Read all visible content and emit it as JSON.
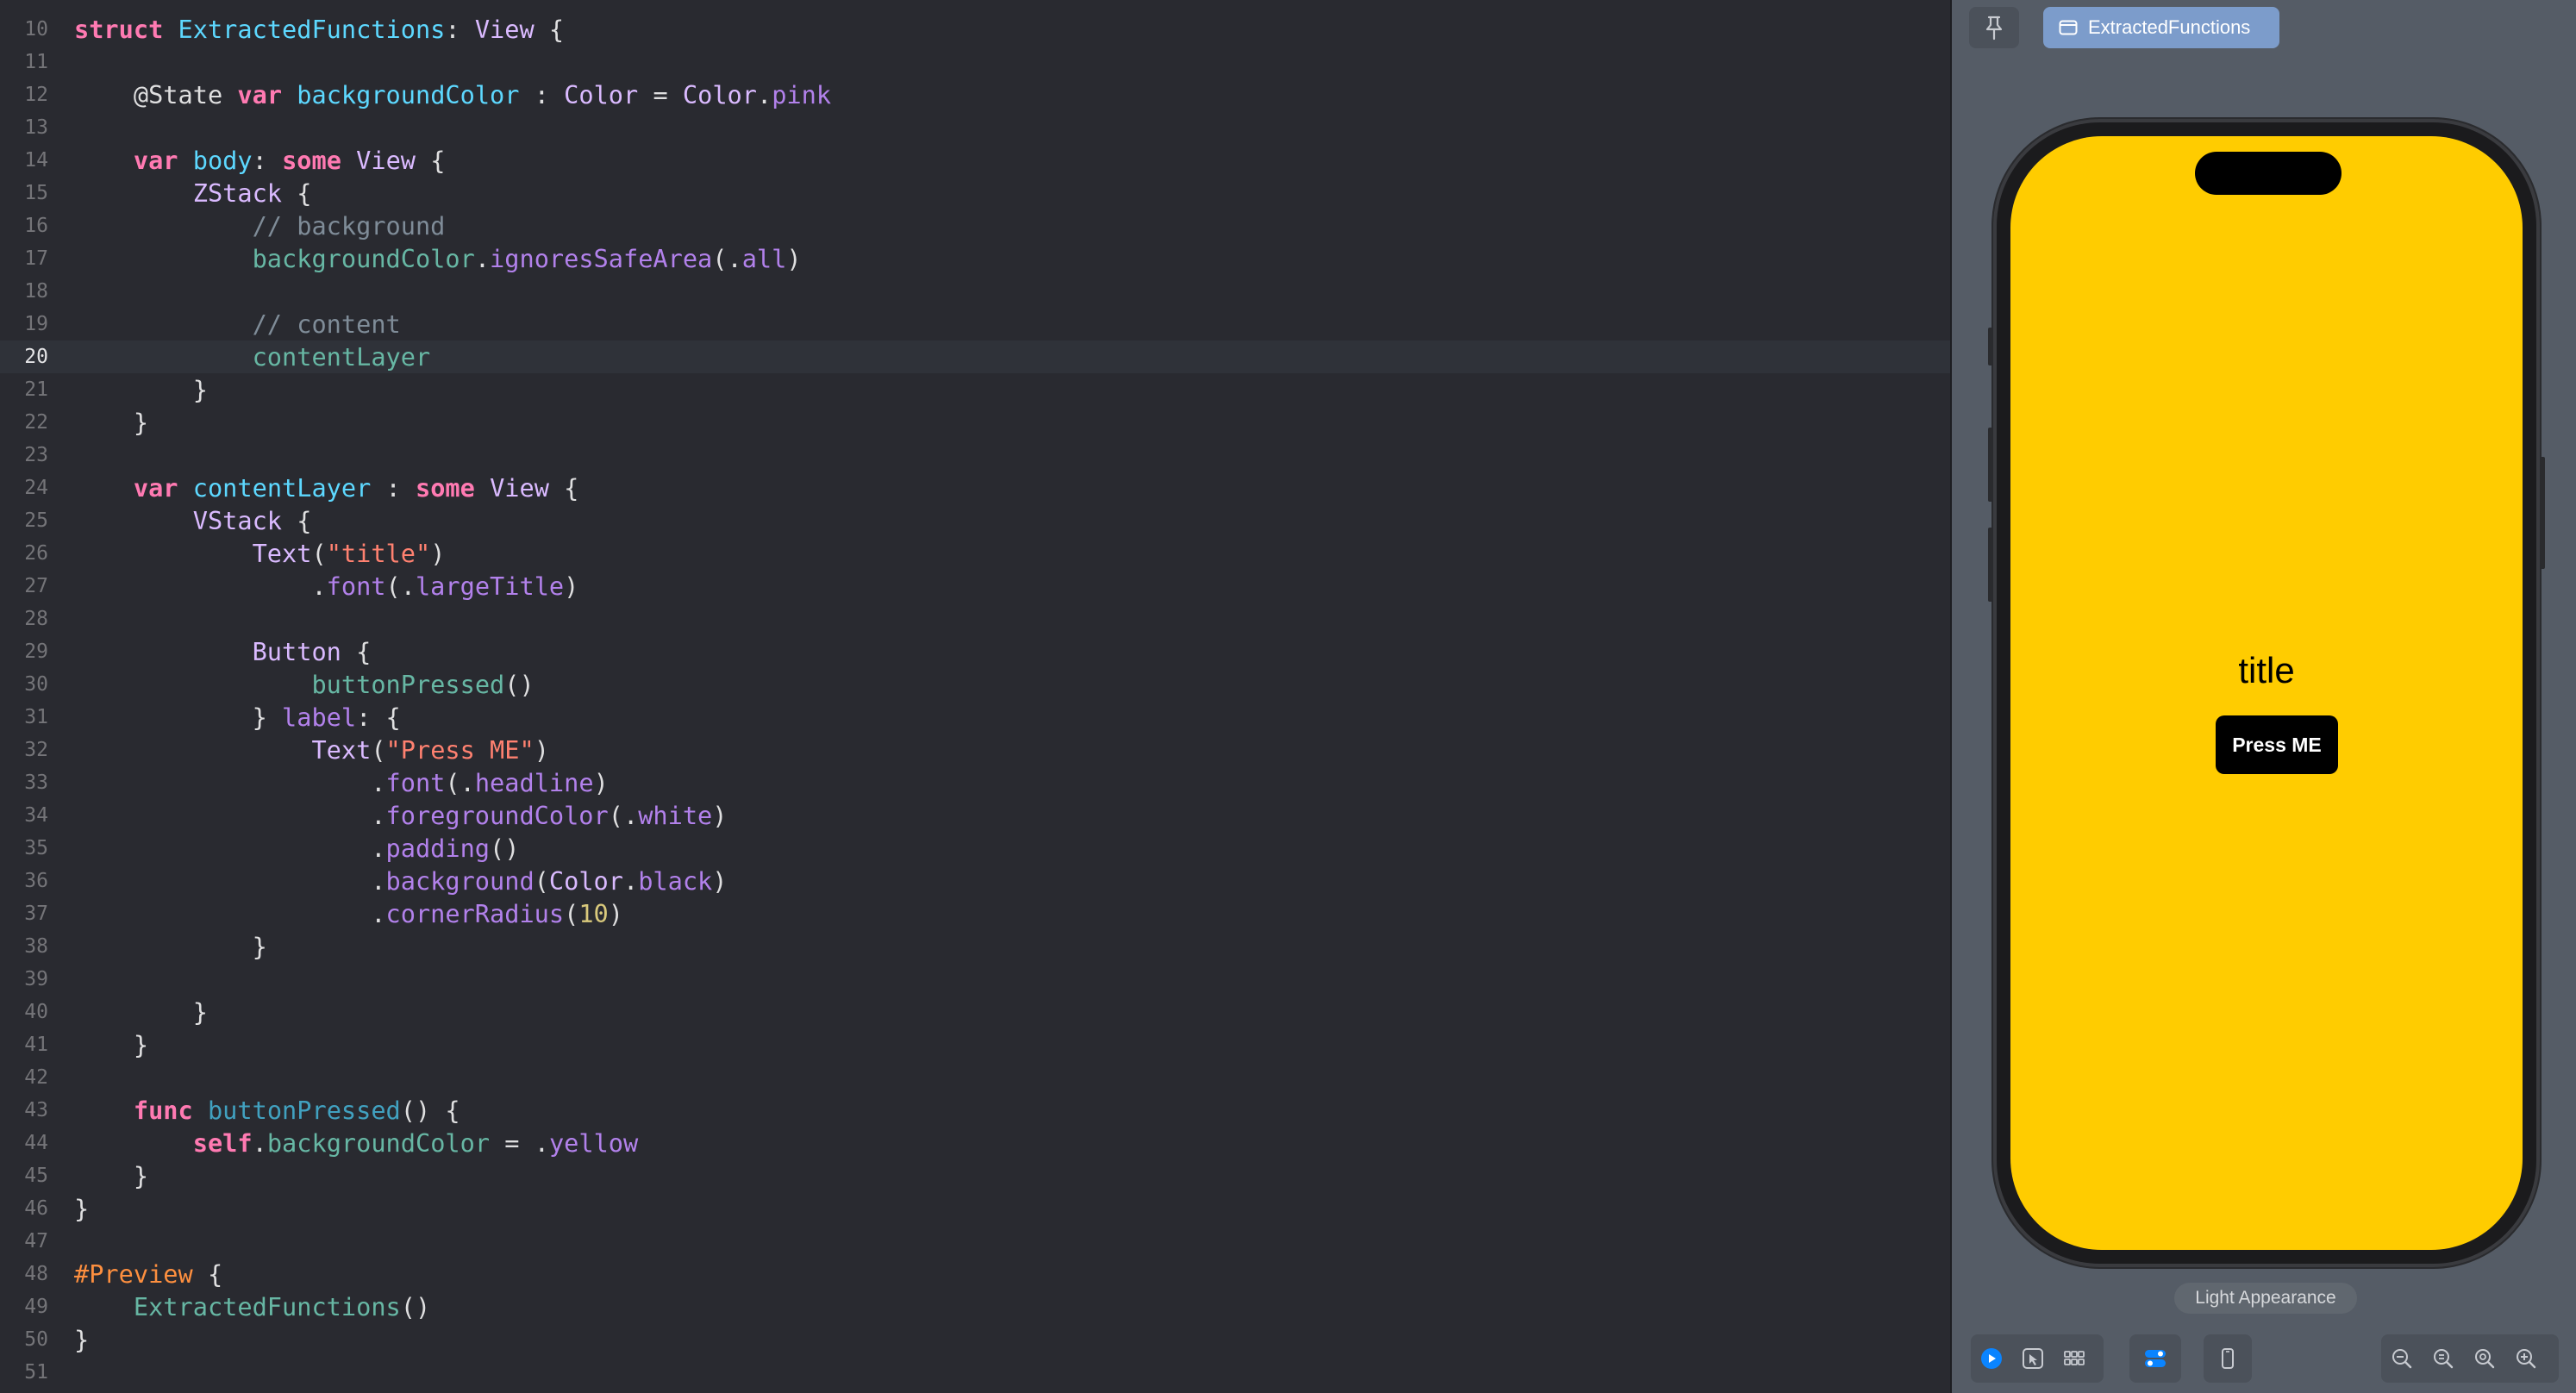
{
  "editor": {
    "current_line": 20,
    "lines": [
      {
        "n": 10,
        "tokens": [
          {
            "t": "struct",
            "c": "kw"
          },
          {
            "t": " ",
            "c": "plain"
          },
          {
            "t": "ExtractedFunctions",
            "c": "decl"
          },
          {
            "t": ": ",
            "c": "plain"
          },
          {
            "t": "View",
            "c": "type"
          },
          {
            "t": " {",
            "c": "plain"
          }
        ]
      },
      {
        "n": 11,
        "tokens": []
      },
      {
        "n": 12,
        "tokens": [
          {
            "t": "    ",
            "c": "plain"
          },
          {
            "t": "@State",
            "c": "attr"
          },
          {
            "t": " ",
            "c": "plain"
          },
          {
            "t": "var",
            "c": "kw"
          },
          {
            "t": " ",
            "c": "plain"
          },
          {
            "t": "backgroundColor",
            "c": "decl"
          },
          {
            "t": " : ",
            "c": "plain"
          },
          {
            "t": "Color",
            "c": "type"
          },
          {
            "t": " = ",
            "c": "plain"
          },
          {
            "t": "Color",
            "c": "type"
          },
          {
            "t": ".",
            "c": "plain"
          },
          {
            "t": "pink",
            "c": "mem"
          }
        ]
      },
      {
        "n": 13,
        "tokens": []
      },
      {
        "n": 14,
        "tokens": [
          {
            "t": "    ",
            "c": "plain"
          },
          {
            "t": "var",
            "c": "kw"
          },
          {
            "t": " ",
            "c": "plain"
          },
          {
            "t": "body",
            "c": "decl"
          },
          {
            "t": ": ",
            "c": "plain"
          },
          {
            "t": "some",
            "c": "kw"
          },
          {
            "t": " ",
            "c": "plain"
          },
          {
            "t": "View",
            "c": "type"
          },
          {
            "t": " {",
            "c": "plain"
          }
        ]
      },
      {
        "n": 15,
        "tokens": [
          {
            "t": "        ",
            "c": "plain"
          },
          {
            "t": "ZStack",
            "c": "type"
          },
          {
            "t": " {",
            "c": "plain"
          }
        ]
      },
      {
        "n": 16,
        "tokens": [
          {
            "t": "            ",
            "c": "plain"
          },
          {
            "t": "// background",
            "c": "cmt"
          }
        ]
      },
      {
        "n": 17,
        "tokens": [
          {
            "t": "            ",
            "c": "plain"
          },
          {
            "t": "backgroundColor",
            "c": "prop"
          },
          {
            "t": ".",
            "c": "plain"
          },
          {
            "t": "ignoresSafeArea",
            "c": "mem"
          },
          {
            "t": "(.",
            "c": "plain"
          },
          {
            "t": "all",
            "c": "mem"
          },
          {
            "t": ")",
            "c": "plain"
          }
        ]
      },
      {
        "n": 18,
        "tokens": []
      },
      {
        "n": 19,
        "tokens": [
          {
            "t": "            ",
            "c": "plain"
          },
          {
            "t": "// content",
            "c": "cmt"
          }
        ]
      },
      {
        "n": 20,
        "tokens": [
          {
            "t": "            ",
            "c": "plain"
          },
          {
            "t": "contentLayer",
            "c": "prop"
          }
        ]
      },
      {
        "n": 21,
        "tokens": [
          {
            "t": "        }",
            "c": "plain"
          }
        ]
      },
      {
        "n": 22,
        "tokens": [
          {
            "t": "    }",
            "c": "plain"
          }
        ]
      },
      {
        "n": 23,
        "tokens": []
      },
      {
        "n": 24,
        "tokens": [
          {
            "t": "    ",
            "c": "plain"
          },
          {
            "t": "var",
            "c": "kw"
          },
          {
            "t": " ",
            "c": "plain"
          },
          {
            "t": "contentLayer",
            "c": "decl"
          },
          {
            "t": " : ",
            "c": "plain"
          },
          {
            "t": "some",
            "c": "kw"
          },
          {
            "t": " ",
            "c": "plain"
          },
          {
            "t": "View",
            "c": "type"
          },
          {
            "t": " {",
            "c": "plain"
          }
        ]
      },
      {
        "n": 25,
        "tokens": [
          {
            "t": "        ",
            "c": "plain"
          },
          {
            "t": "VStack",
            "c": "type"
          },
          {
            "t": " {",
            "c": "plain"
          }
        ]
      },
      {
        "n": 26,
        "tokens": [
          {
            "t": "            ",
            "c": "plain"
          },
          {
            "t": "Text",
            "c": "type"
          },
          {
            "t": "(",
            "c": "plain"
          },
          {
            "t": "\"title\"",
            "c": "str"
          },
          {
            "t": ")",
            "c": "plain"
          }
        ]
      },
      {
        "n": 27,
        "tokens": [
          {
            "t": "                .",
            "c": "plain"
          },
          {
            "t": "font",
            "c": "mem"
          },
          {
            "t": "(.",
            "c": "plain"
          },
          {
            "t": "largeTitle",
            "c": "mem"
          },
          {
            "t": ")",
            "c": "plain"
          }
        ]
      },
      {
        "n": 28,
        "tokens": []
      },
      {
        "n": 29,
        "tokens": [
          {
            "t": "            ",
            "c": "plain"
          },
          {
            "t": "Button",
            "c": "type"
          },
          {
            "t": " {",
            "c": "plain"
          }
        ]
      },
      {
        "n": 30,
        "tokens": [
          {
            "t": "                ",
            "c": "plain"
          },
          {
            "t": "buttonPressed",
            "c": "prop"
          },
          {
            "t": "()",
            "c": "plain"
          }
        ]
      },
      {
        "n": 31,
        "tokens": [
          {
            "t": "            } ",
            "c": "plain"
          },
          {
            "t": "label",
            "c": "mem"
          },
          {
            "t": ": {",
            "c": "plain"
          }
        ]
      },
      {
        "n": 32,
        "tokens": [
          {
            "t": "                ",
            "c": "plain"
          },
          {
            "t": "Text",
            "c": "type"
          },
          {
            "t": "(",
            "c": "plain"
          },
          {
            "t": "\"Press ME\"",
            "c": "str"
          },
          {
            "t": ")",
            "c": "plain"
          }
        ]
      },
      {
        "n": 33,
        "tokens": [
          {
            "t": "                    .",
            "c": "plain"
          },
          {
            "t": "font",
            "c": "mem"
          },
          {
            "t": "(.",
            "c": "plain"
          },
          {
            "t": "headline",
            "c": "mem"
          },
          {
            "t": ")",
            "c": "plain"
          }
        ]
      },
      {
        "n": 34,
        "tokens": [
          {
            "t": "                    .",
            "c": "plain"
          },
          {
            "t": "foregroundColor",
            "c": "mem"
          },
          {
            "t": "(.",
            "c": "plain"
          },
          {
            "t": "white",
            "c": "mem"
          },
          {
            "t": ")",
            "c": "plain"
          }
        ]
      },
      {
        "n": 35,
        "tokens": [
          {
            "t": "                    .",
            "c": "plain"
          },
          {
            "t": "padding",
            "c": "mem"
          },
          {
            "t": "()",
            "c": "plain"
          }
        ]
      },
      {
        "n": 36,
        "tokens": [
          {
            "t": "                    .",
            "c": "plain"
          },
          {
            "t": "background",
            "c": "mem"
          },
          {
            "t": "(",
            "c": "plain"
          },
          {
            "t": "Color",
            "c": "type"
          },
          {
            "t": ".",
            "c": "plain"
          },
          {
            "t": "black",
            "c": "mem"
          },
          {
            "t": ")",
            "c": "plain"
          }
        ]
      },
      {
        "n": 37,
        "tokens": [
          {
            "t": "                    .",
            "c": "plain"
          },
          {
            "t": "cornerRadius",
            "c": "mem"
          },
          {
            "t": "(",
            "c": "plain"
          },
          {
            "t": "10",
            "c": "num"
          },
          {
            "t": ")",
            "c": "plain"
          }
        ]
      },
      {
        "n": 38,
        "tokens": [
          {
            "t": "            }",
            "c": "plain"
          }
        ]
      },
      {
        "n": 39,
        "tokens": []
      },
      {
        "n": 40,
        "tokens": [
          {
            "t": "        }",
            "c": "plain"
          }
        ]
      },
      {
        "n": 41,
        "tokens": [
          {
            "t": "    }",
            "c": "plain"
          }
        ]
      },
      {
        "n": 42,
        "tokens": []
      },
      {
        "n": 43,
        "tokens": [
          {
            "t": "    ",
            "c": "plain"
          },
          {
            "t": "func",
            "c": "kw"
          },
          {
            "t": " ",
            "c": "plain"
          },
          {
            "t": "buttonPressed",
            "c": "func"
          },
          {
            "t": "() {",
            "c": "plain"
          }
        ]
      },
      {
        "n": 44,
        "tokens": [
          {
            "t": "        ",
            "c": "plain"
          },
          {
            "t": "self",
            "c": "kw"
          },
          {
            "t": ".",
            "c": "plain"
          },
          {
            "t": "backgroundColor",
            "c": "prop"
          },
          {
            "t": " = .",
            "c": "plain"
          },
          {
            "t": "yellow",
            "c": "mem"
          }
        ]
      },
      {
        "n": 45,
        "tokens": [
          {
            "t": "    }",
            "c": "plain"
          }
        ]
      },
      {
        "n": 46,
        "tokens": [
          {
            "t": "}",
            "c": "plain"
          }
        ]
      },
      {
        "n": 47,
        "tokens": []
      },
      {
        "n": 48,
        "tokens": [
          {
            "t": "#Preview",
            "c": "macro"
          },
          {
            "t": " {",
            "c": "plain"
          }
        ]
      },
      {
        "n": 49,
        "tokens": [
          {
            "t": "    ",
            "c": "plain"
          },
          {
            "t": "ExtractedFunctions",
            "c": "prop"
          },
          {
            "t": "()",
            "c": "plain"
          }
        ]
      },
      {
        "n": 50,
        "tokens": [
          {
            "t": "}",
            "c": "plain"
          }
        ]
      },
      {
        "n": 51,
        "tokens": []
      }
    ]
  },
  "preview": {
    "tab_label": "ExtractedFunctions",
    "screen_background": "#ffcc00",
    "app_title": "title",
    "app_button_label": "Press ME",
    "appearance_label": "Light Appearance",
    "toolbar_left": [
      {
        "name": "live-preview-icon",
        "active": true
      },
      {
        "name": "selectable-mode-icon",
        "active": false
      },
      {
        "name": "variants-grid-icon",
        "active": false
      }
    ],
    "toolbar_middle": [
      {
        "name": "device-settings-icon",
        "active": true
      },
      {
        "name": "device-icon",
        "active": false
      }
    ],
    "toolbar_right": [
      {
        "name": "zoom-out-icon"
      },
      {
        "name": "zoom-100-icon"
      },
      {
        "name": "zoom-fit-icon"
      },
      {
        "name": "zoom-in-icon"
      }
    ]
  },
  "colors": {
    "editor_bg": "#292a30",
    "keyword": "#ff7ab2",
    "type": "#dabaff",
    "declaration": "#5dd8ff",
    "string": "#ff8170",
    "number": "#d9c97c",
    "comment": "#7f8c98",
    "accent_blue": "#0a84ff"
  }
}
